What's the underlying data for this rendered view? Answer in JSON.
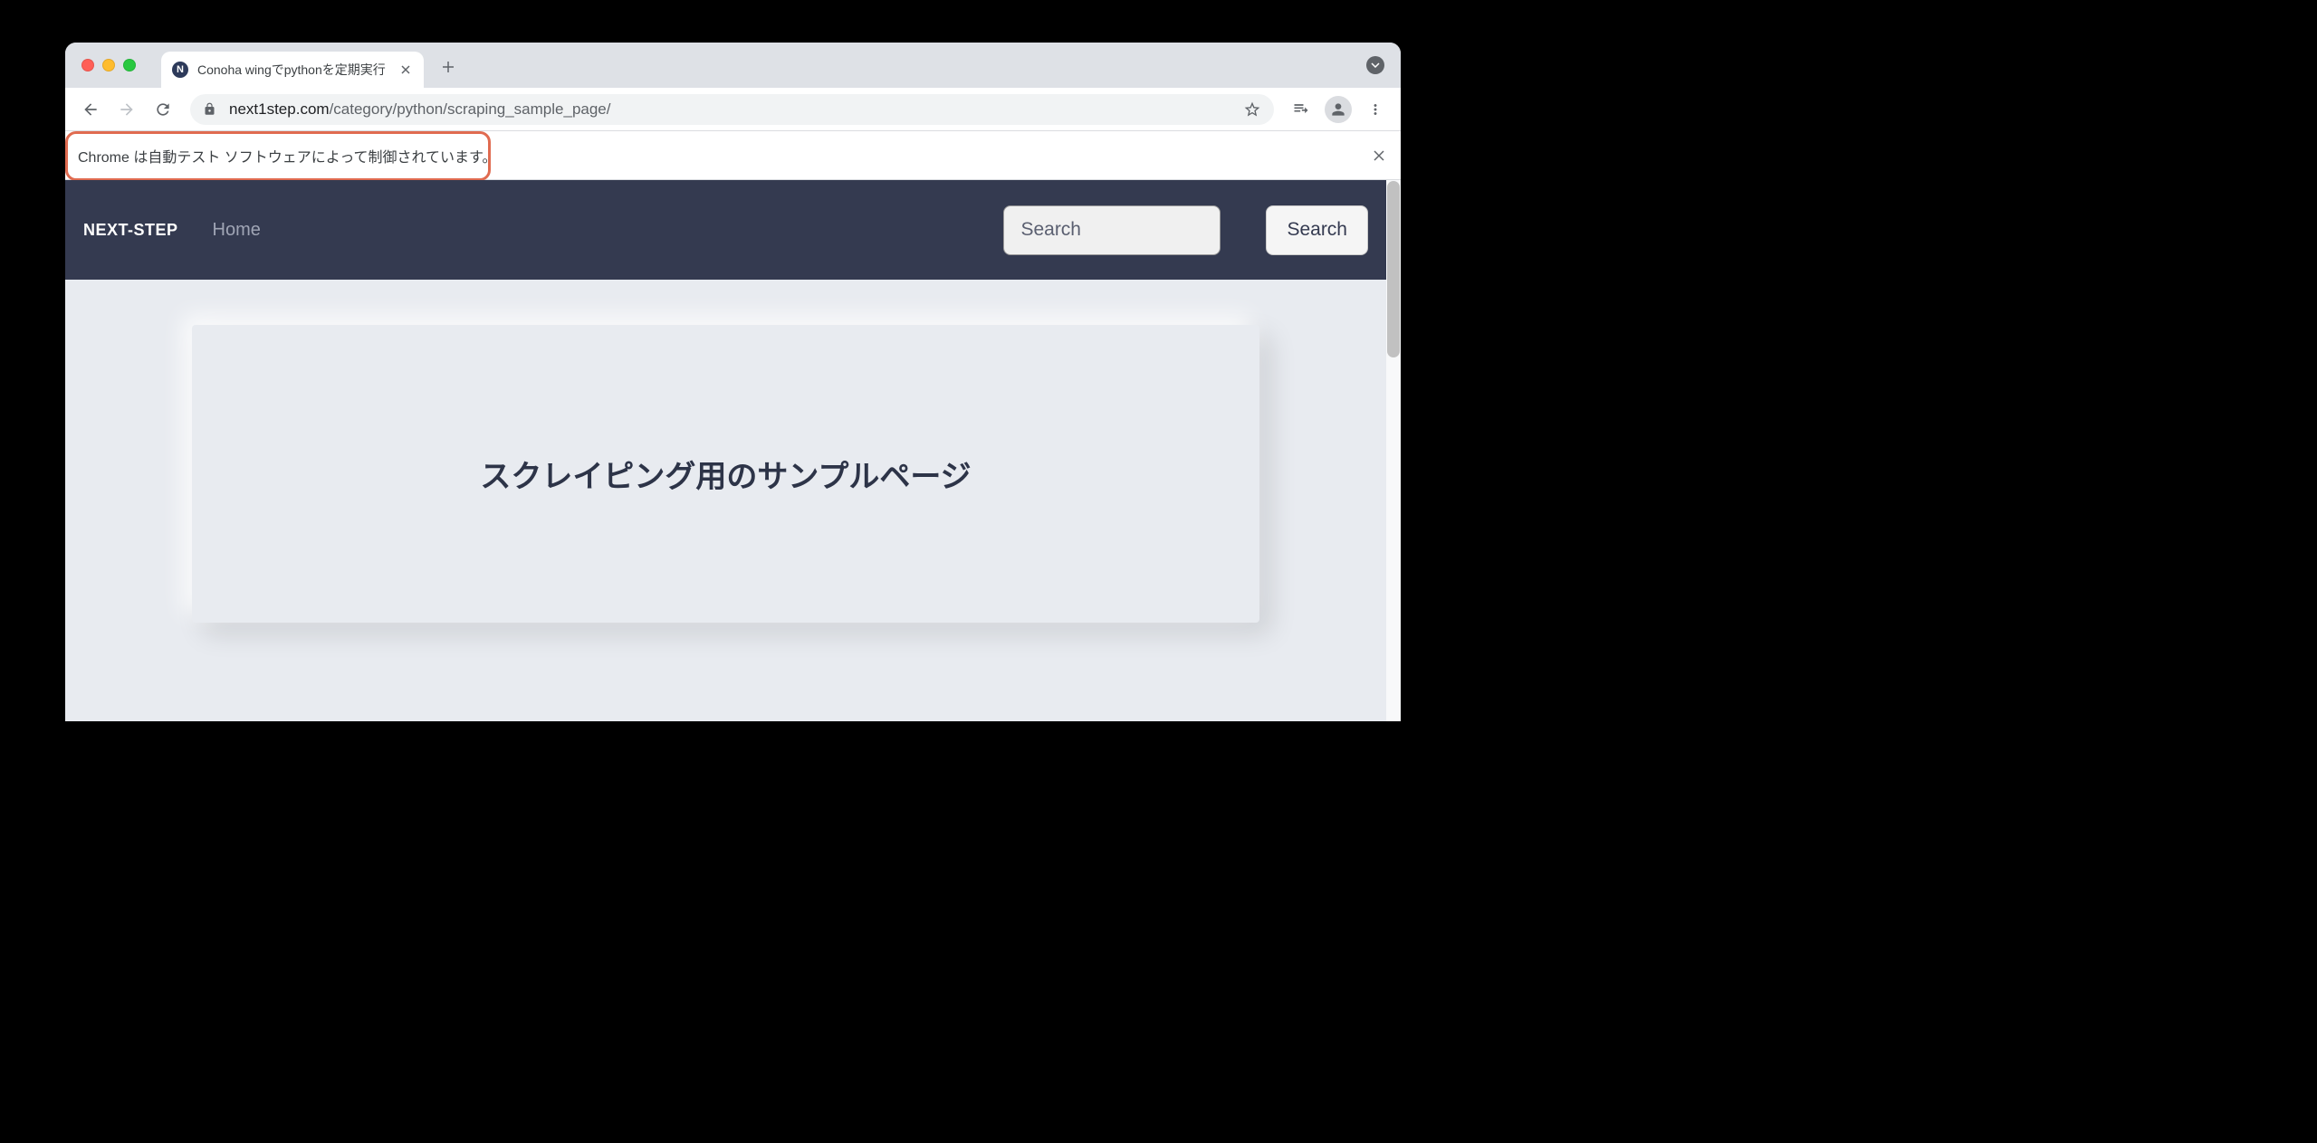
{
  "browser": {
    "tab_title": "Conoha wingでpythonを定期実行",
    "url_domain": "next1step.com",
    "url_path": "/category/python/scraping_sample_page/",
    "infobar_text": "Chrome は自動テスト ソフトウェアによって制御されています。"
  },
  "site": {
    "brand": "NEXT-STEP",
    "nav_home": "Home",
    "search_placeholder": "Search",
    "search_button": "Search"
  },
  "page": {
    "heading": "スクレイピング用のサンプルページ"
  }
}
